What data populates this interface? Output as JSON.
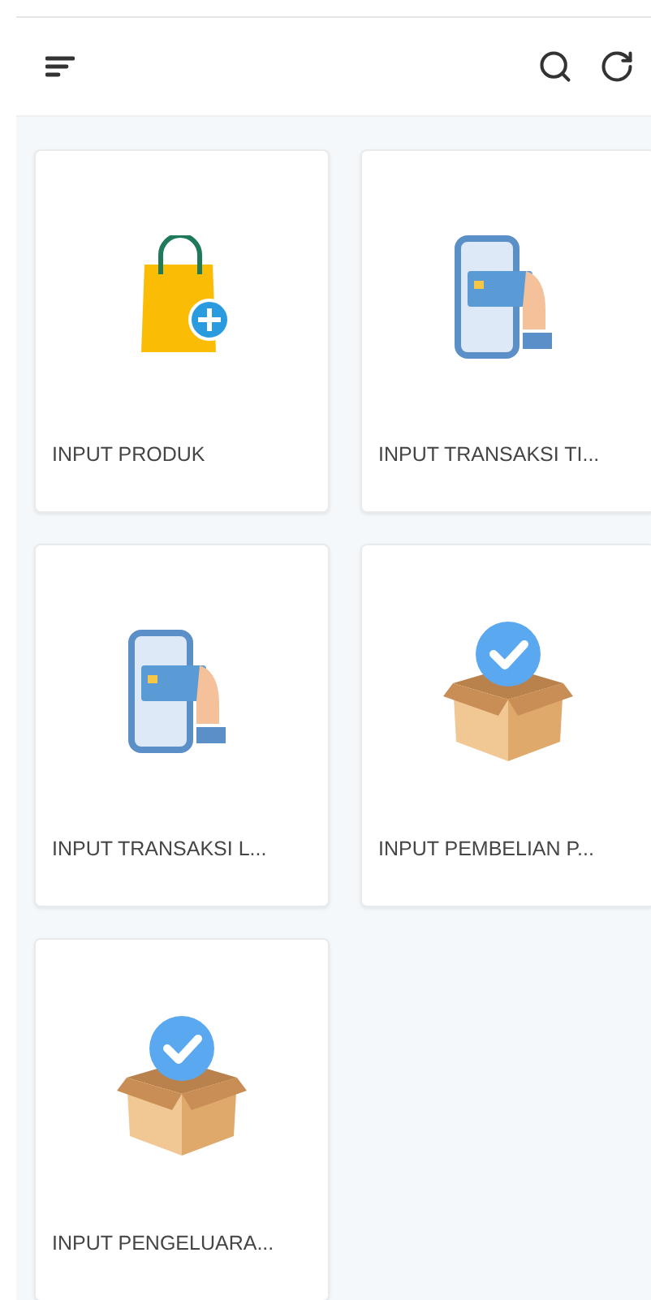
{
  "toolbar": [
    {
      "kind": "sort"
    },
    {
      "kind": "spacer"
    },
    {
      "kind": "search"
    },
    {
      "kind": "refresh"
    }
  ],
  "cards": [
    {
      "label": "INPUT PRODUK",
      "kind": "bag"
    },
    {
      "label": "INPUT TRANSAKSI TI...",
      "kind": "phone"
    },
    {
      "label": "INPUT TRANSAKSI L...",
      "kind": "phone"
    },
    {
      "label": "INPUT PEMBELIAN P...",
      "kind": "box"
    },
    {
      "label": "INPUT PENGELUARA...",
      "kind": "box"
    }
  ]
}
